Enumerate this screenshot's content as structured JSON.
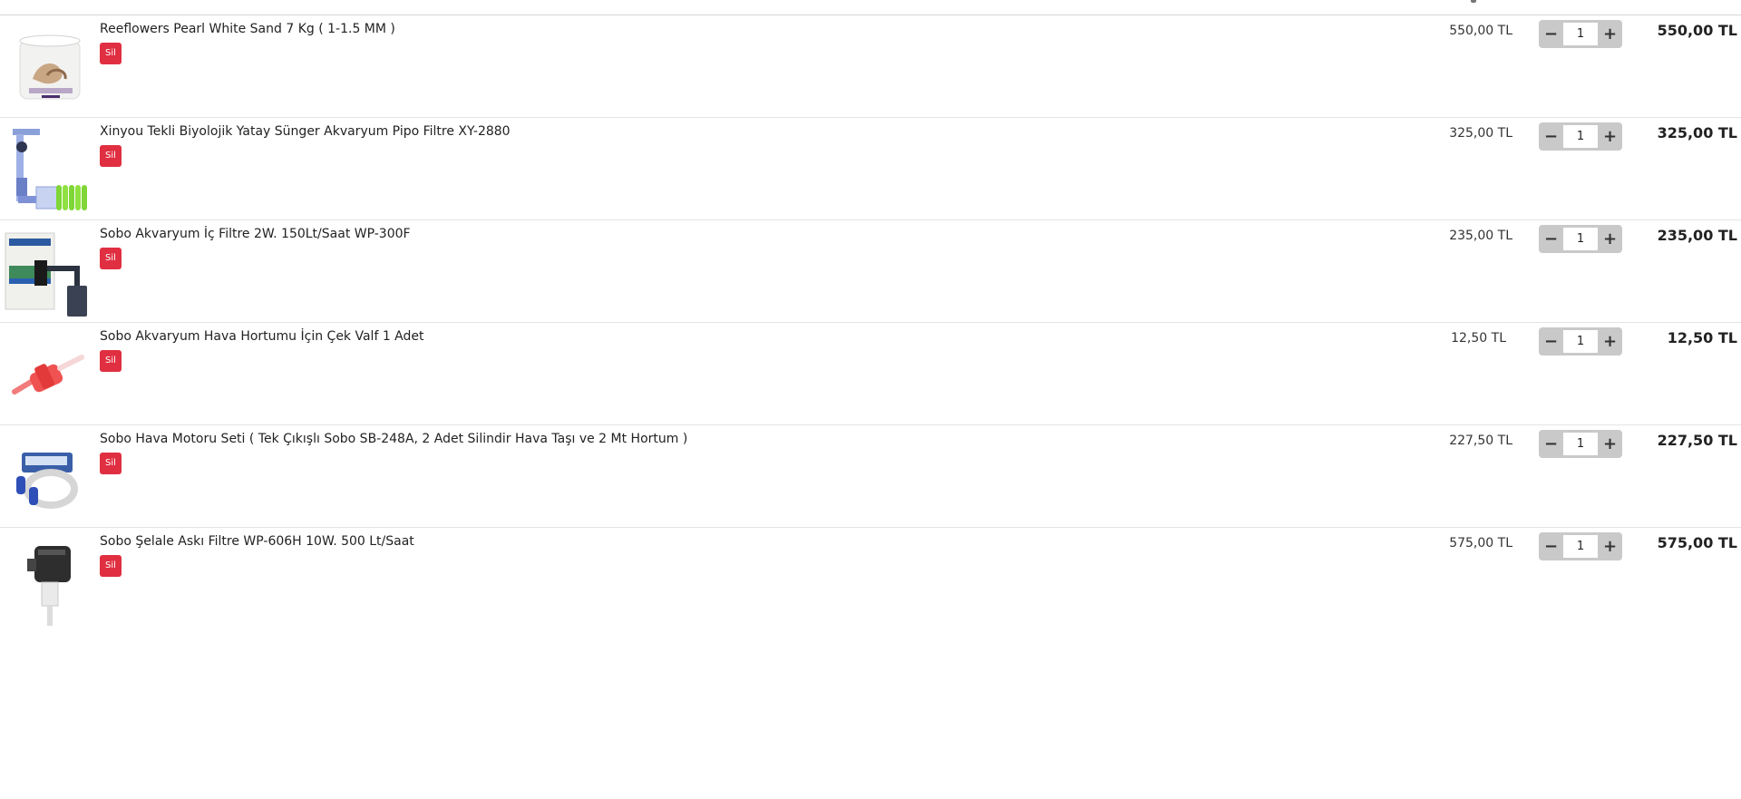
{
  "cart": {
    "currency": "TL",
    "delete_label": "Sil",
    "minus_glyph": "−",
    "plus_glyph": "+",
    "items": [
      {
        "title": "Reeflowers Pearl White Sand 7 Kg ( 1-1.5 MM )",
        "unit_price": "550,00 TL",
        "quantity": "1",
        "line_total": "550,00 TL",
        "thumbnail": "sand-bucket-image"
      },
      {
        "title": "Xinyou Tekli Biyolojik Yatay Sünger Akvaryum Pipo Filtre XY-2880",
        "unit_price": "325,00 TL",
        "quantity": "1",
        "line_total": "325,00 TL",
        "thumbnail": "sponge-filter-image"
      },
      {
        "title": "Sobo Akvaryum İç Filtre 2W. 150Lt/Saat WP-300F",
        "unit_price": "235,00 TL",
        "quantity": "1",
        "line_total": "235,00 TL",
        "thumbnail": "internal-filter-image"
      },
      {
        "title": "Sobo Akvaryum Hava Hortumu İçin Çek Valf 1 Adet",
        "unit_price": "12,50 TL",
        "quantity": "1",
        "line_total": "12,50 TL",
        "thumbnail": "check-valve-image"
      },
      {
        "title": "Sobo Hava Motoru Seti ( Tek Çıkışlı Sobo SB-248A, 2 Adet Silindir Hava Taşı ve 2 Mt Hortum )",
        "unit_price": "227,50 TL",
        "quantity": "1",
        "line_total": "227,50 TL",
        "thumbnail": "air-pump-set-image"
      },
      {
        "title": "Sobo Şelale Askı Filtre WP-606H 10W. 500 Lt/Saat",
        "unit_price": "575,00 TL",
        "quantity": "1",
        "line_total": "575,00 TL",
        "thumbnail": "hang-on-filter-image"
      }
    ]
  },
  "colors": {
    "delete_button": "#e02f41",
    "stepper_bg": "#c9c9c9",
    "divider": "#e4e4e4"
  }
}
